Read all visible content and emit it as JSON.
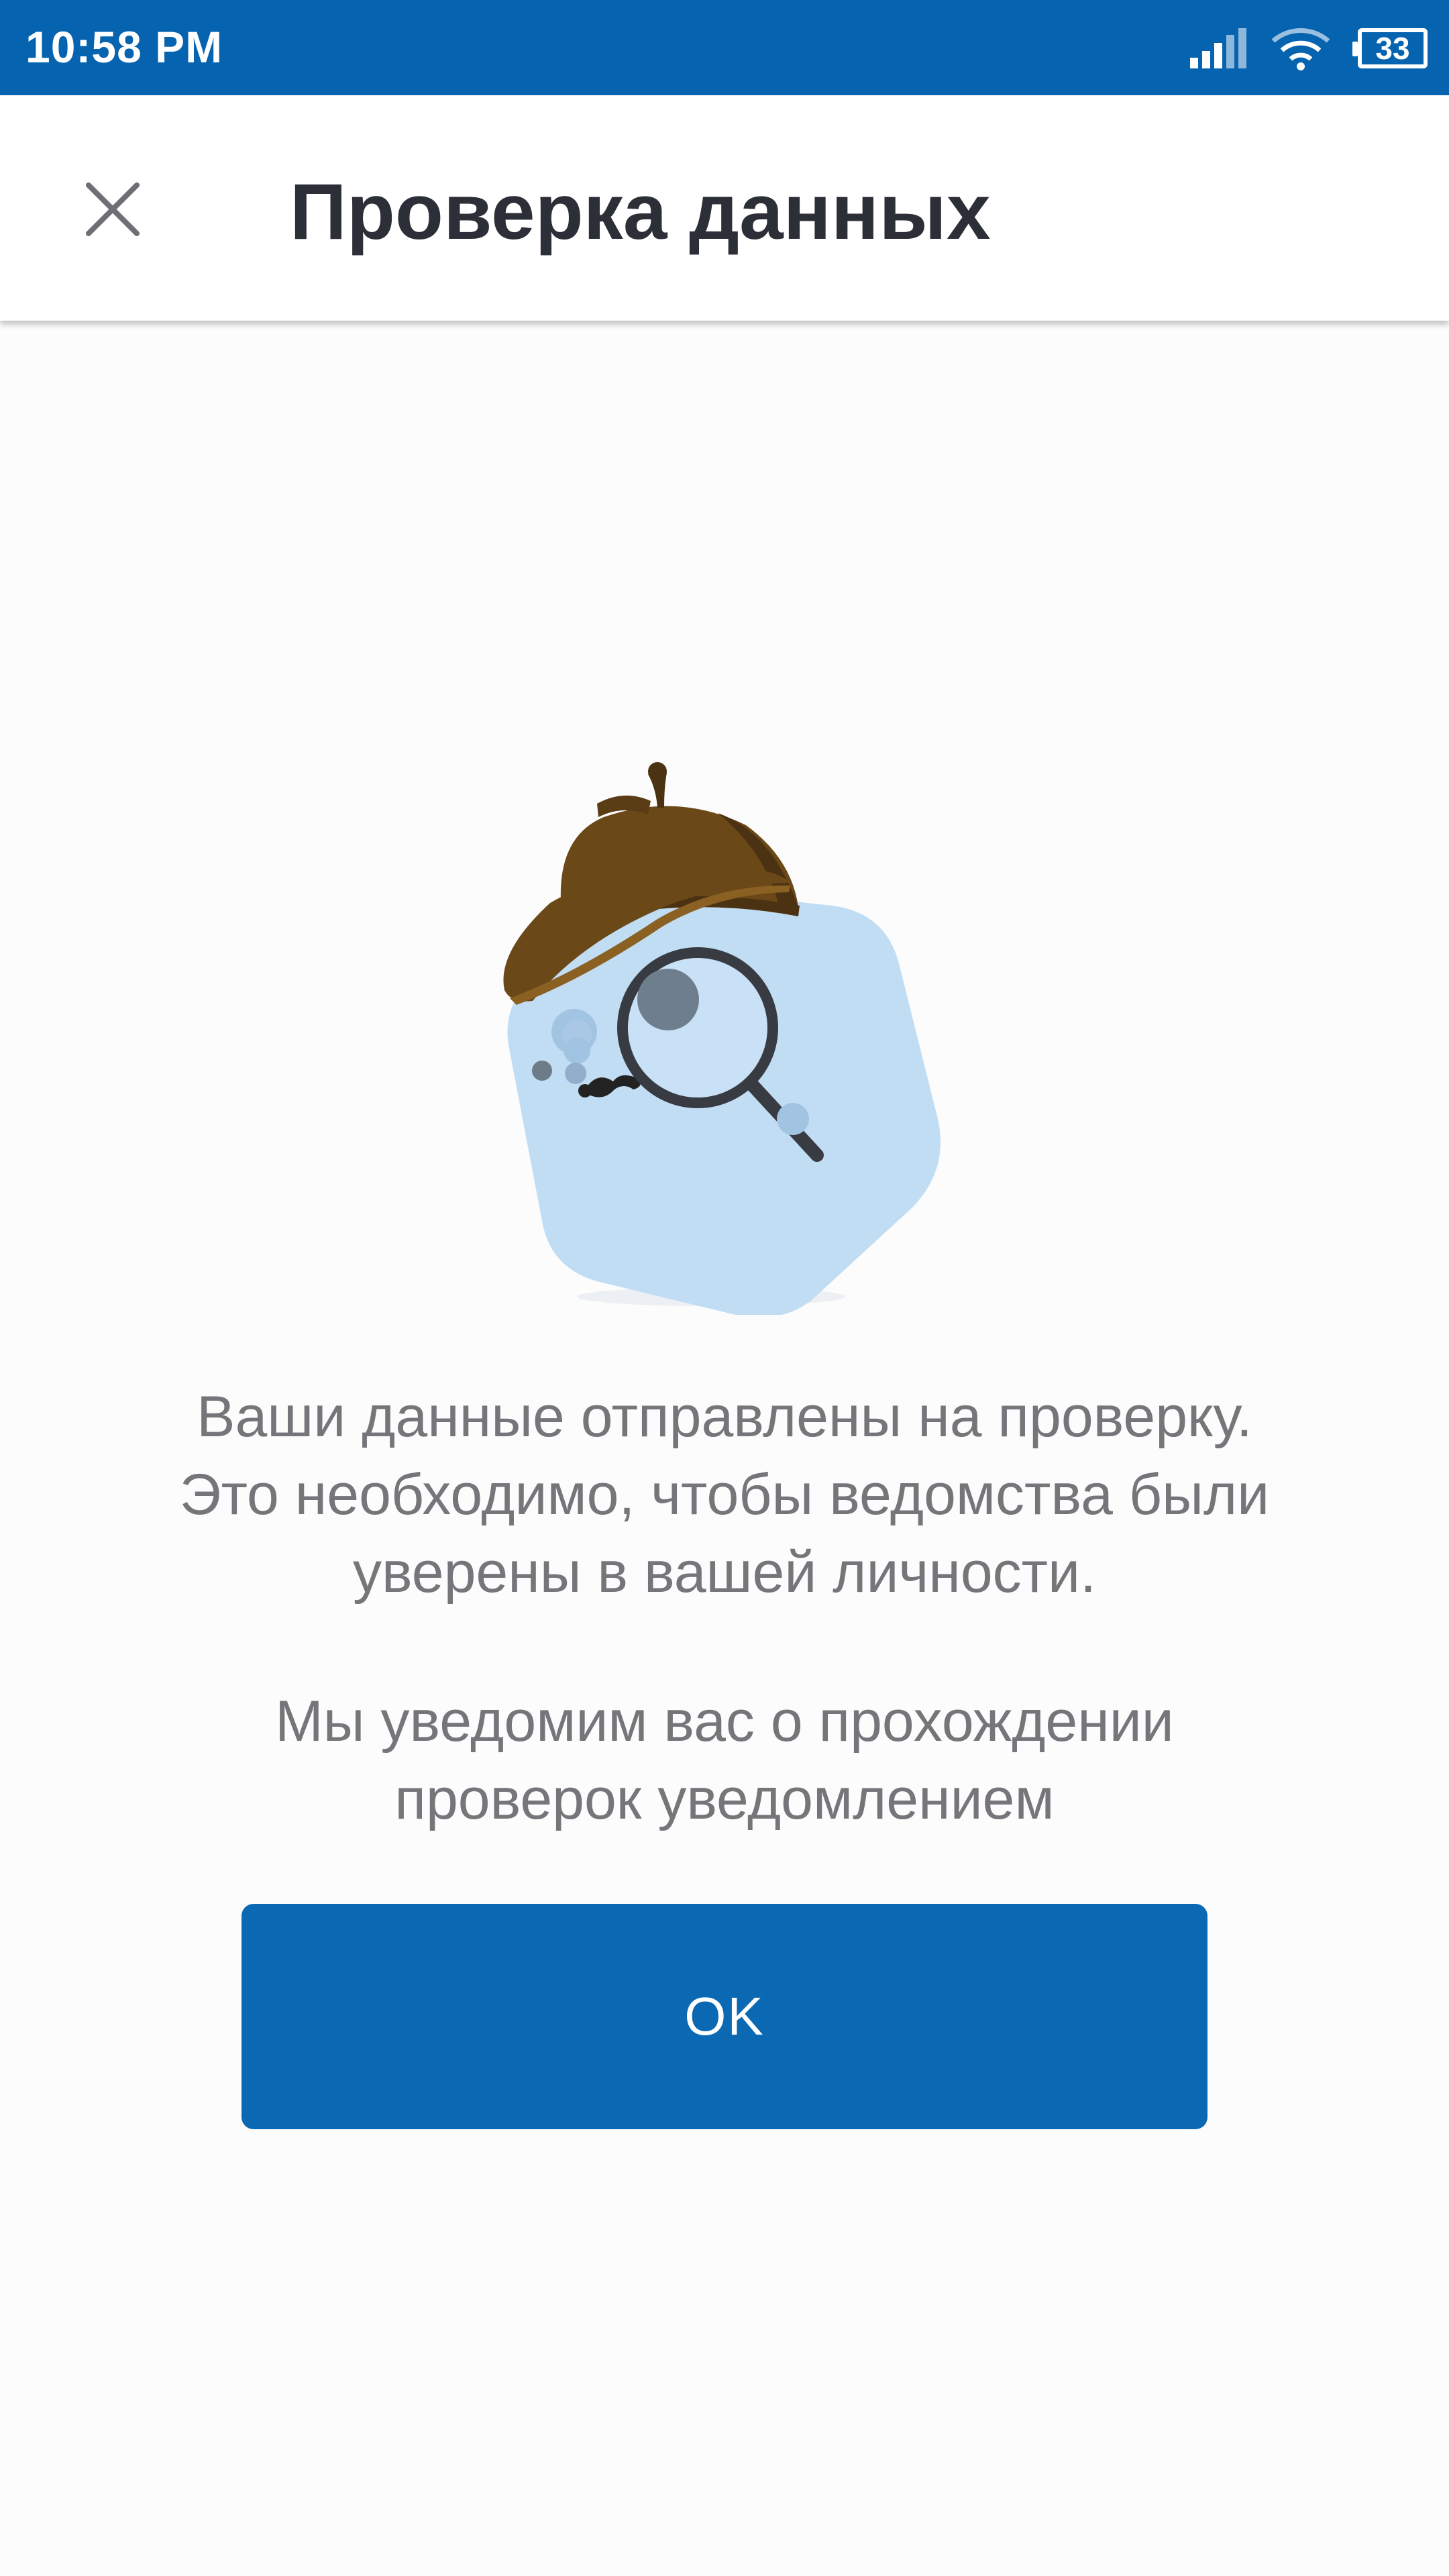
{
  "status_bar": {
    "time": "10:58 PM",
    "battery": "33",
    "icons": [
      "signal-icon",
      "wifi-icon",
      "battery-icon"
    ]
  },
  "toolbar": {
    "close_icon": "close-icon",
    "title": "Проверка данных"
  },
  "illustration": {
    "icon": "detective-magnifier-illustration"
  },
  "content": {
    "message_lines": [
      "Ваши данные отправлены на проверку.",
      "Это необходимо, чтобы ведомства были",
      "уверены в вашей личности."
    ],
    "notice_lines": [
      "Мы уведомим вас о прохождении",
      "проверок уведомлением"
    ]
  },
  "actions": {
    "ok_label": "OK"
  },
  "colors": {
    "primary": "#0b68b3",
    "status_bar": "#0563b0",
    "title_text": "#2d2f38",
    "body_text": "#75767a",
    "illustration_bg": "#c1ddf3",
    "hat": "#6b4818"
  }
}
